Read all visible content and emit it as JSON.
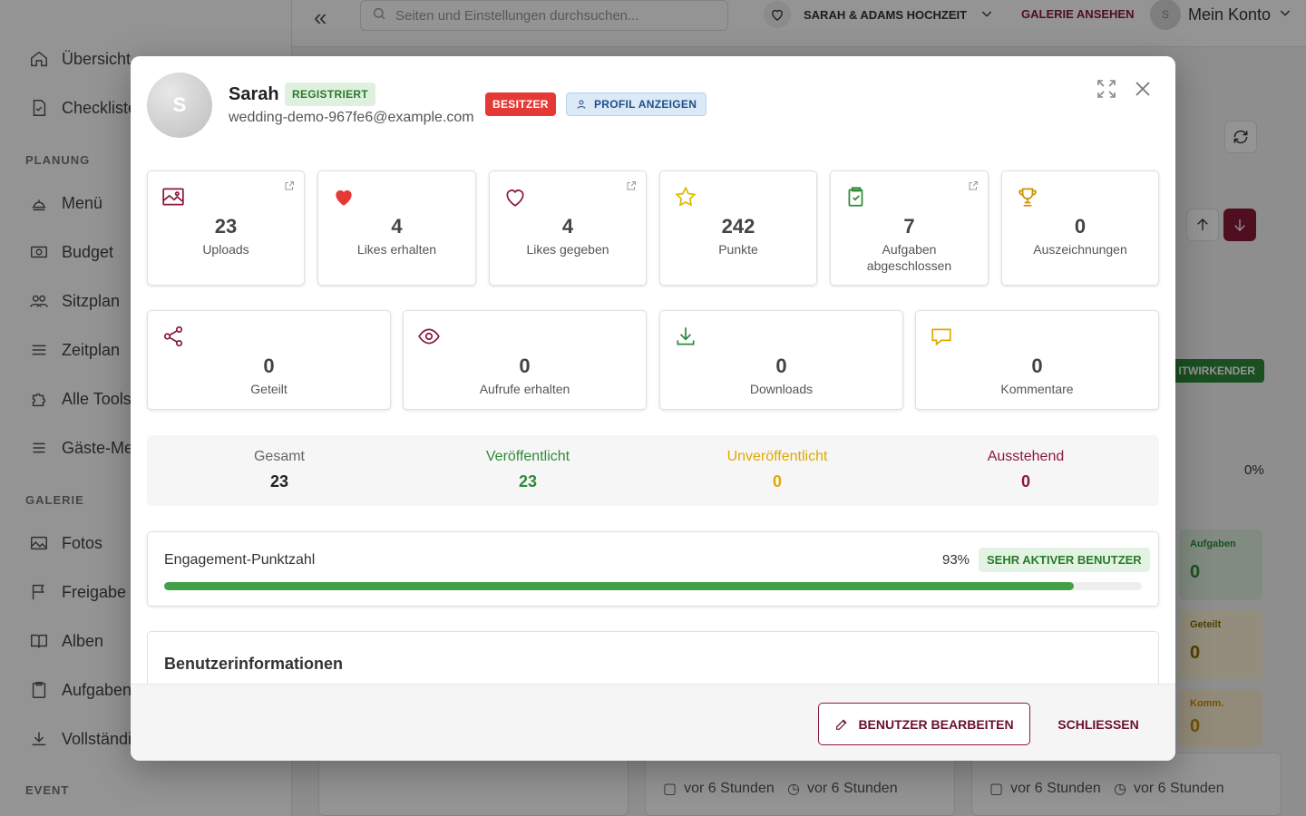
{
  "sidebar": {
    "items": [
      {
        "label": "Übersicht",
        "icon": "home-icon"
      },
      {
        "label": "Checkliste",
        "icon": "checklist-icon"
      },
      {
        "label": "Menü",
        "icon": "food-icon"
      },
      {
        "label": "Budget",
        "icon": "money-icon"
      },
      {
        "label": "Sitzplan",
        "icon": "people-icon"
      },
      {
        "label": "Zeitplan",
        "icon": "list-icon"
      },
      {
        "label": "Alle Tools",
        "icon": "puzzle-icon"
      },
      {
        "label": "Gäste-Menü",
        "icon": "menu-icon"
      },
      {
        "label": "Fotos",
        "icon": "image-icon"
      },
      {
        "label": "Freigabe",
        "icon": "flag-icon"
      },
      {
        "label": "Alben",
        "icon": "book-icon"
      },
      {
        "label": "Aufgaben",
        "icon": "clipboard-icon"
      },
      {
        "label": "Vollständig",
        "icon": "download-icon"
      }
    ],
    "sections": {
      "planning": "PLANUNG",
      "gallery": "GALERIE",
      "event": "EVENT"
    }
  },
  "topbar": {
    "search_placeholder": "Seiten und Einstellungen durchsuchen...",
    "event_name": "SARAH & ADAMS HOCHZEIT",
    "gallery_link": "GALERIE ANSEHEN",
    "account_label": "Mein Konto",
    "account_initial": "S"
  },
  "background": {
    "role_badge": "ITWIRKENDER",
    "percent": "0%",
    "side_stats": [
      {
        "label": "Aufgaben",
        "value": "0"
      },
      {
        "label": "Geteilt",
        "value": "0"
      },
      {
        "label": "Komm.",
        "value": "0"
      }
    ],
    "times": [
      "vor 6 Stunden",
      "vor 6 Stunden",
      "vor 6 Stunden",
      "vor 6 Stunden"
    ]
  },
  "modal": {
    "avatar_initial": "S",
    "name": "Sarah",
    "registered_badge": "REGISTRIERT",
    "email": "wedding-demo-967fe6@example.com",
    "owner_badge": "BESITZER",
    "profile_button": "PROFIL ANZEIGEN",
    "stats_row1": [
      {
        "value": "23",
        "label": "Uploads",
        "icon": "image-icon"
      },
      {
        "value": "4",
        "label": "Likes erhalten",
        "icon": "heart-filled-icon"
      },
      {
        "value": "4",
        "label": "Likes gegeben",
        "icon": "heart-outline-icon"
      },
      {
        "value": "242",
        "label": "Punkte",
        "icon": "star-icon"
      },
      {
        "value": "7",
        "label": "Aufgaben abgeschlossen",
        "icon": "clipboard-check-icon"
      },
      {
        "value": "0",
        "label": "Auszeichnungen",
        "icon": "trophy-icon"
      }
    ],
    "stats_row2": [
      {
        "value": "0",
        "label": "Geteilt",
        "icon": "share-icon"
      },
      {
        "value": "0",
        "label": "Aufrufe erhalten",
        "icon": "eye-icon"
      },
      {
        "value": "0",
        "label": "Downloads",
        "icon": "download-icon"
      },
      {
        "value": "0",
        "label": "Kommentare",
        "icon": "comment-icon"
      }
    ],
    "summary": [
      {
        "label": "Gesamt",
        "value": "23",
        "color": "#666666",
        "value_color": "#222222"
      },
      {
        "label": "Veröffentlicht",
        "value": "23",
        "color": "#2e8b3a",
        "value_color": "#2e8b3a"
      },
      {
        "label": "Unveröffentlicht",
        "value": "0",
        "color": "#e0a800",
        "value_color": "#e0a800"
      },
      {
        "label": "Ausstehend",
        "value": "0",
        "color": "#8b1a3a",
        "value_color": "#8b1a3a"
      }
    ],
    "engagement": {
      "title": "Engagement-Punktzahl",
      "percent_label": "93%",
      "percent": 93,
      "level": "SEHR AKTIVER BENUTZER"
    },
    "info_title": "Benutzerinformationen",
    "edit_button": "BENUTZER BEARBEITEN",
    "close_button": "SCHLIESSEN"
  },
  "colors": {
    "brand": "#8b1a3a",
    "success": "#43a047",
    "danger": "#e53935",
    "warning": "#e0a800"
  }
}
